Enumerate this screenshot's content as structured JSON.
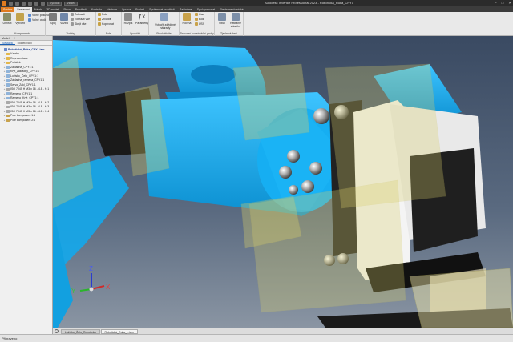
{
  "window": {
    "title": "Autodesk Inventor Professional 2023 - Robotická_Ruka_CPY1",
    "document_combo": "Výchozí",
    "appearance_combo": "Vzhled"
  },
  "tabs": [
    {
      "label": "Soubor",
      "state": "file"
    },
    {
      "label": "Sestavení",
      "state": "active"
    },
    {
      "label": "Návrh",
      "state": ""
    },
    {
      "label": "3D model",
      "state": ""
    },
    {
      "label": "Skica",
      "state": ""
    },
    {
      "label": "Prostředí",
      "state": ""
    },
    {
      "label": "Kontrola",
      "state": ""
    },
    {
      "label": "Nástroje",
      "state": ""
    },
    {
      "label": "Správa",
      "state": ""
    },
    {
      "label": "Pohled",
      "state": ""
    },
    {
      "label": "Systémové prostředí",
      "state": ""
    },
    {
      "label": "Začínáme",
      "state": ""
    },
    {
      "label": "Spolupracovat",
      "state": ""
    },
    {
      "label": "Elektromechanické",
      "state": ""
    }
  ],
  "ribbon": {
    "komponenta": {
      "label": "Komponenta",
      "place": "Umístit",
      "create": "Vytvořit",
      "free_move": "Volně posunout",
      "free_rotate": "Volně otočit"
    },
    "vztahy": {
      "label": "Vztahy",
      "join": "Spoj",
      "constrain": "Vazba",
      "show": "Zobrazit",
      "show_all": "Zobrazit vše",
      "hide_all": "Skrýt vše"
    },
    "pole": {
      "label": "Pole",
      "pattern": "Pole",
      "mirror": "Zrcadlit",
      "copy": "Kopírovat"
    },
    "spoustec": {
      "label": "Spouště",
      "design": "Rozpis",
      "params": "Parametry"
    },
    "produktivita": {
      "label": "Produktivita",
      "create_subs": "Vytvořit zděděné náhrady"
    },
    "pracovni": {
      "label": "Pracovní konstrukční prvky",
      "plane": "Rovina",
      "axis": "Osa",
      "point": "Bod",
      "ucs": "USS"
    },
    "zjednoduseni": {
      "label": "Zjednodušení",
      "wrap": "Obal",
      "shrinkwrap": "Rektálně zdadění"
    }
  },
  "browser": {
    "header": "Model",
    "add": "+",
    "tab_assembly": "Sestava",
    "tab_model": "Modelování",
    "tree": [
      {
        "label": "Robotická_Ruka_CPY1.iam",
        "level": 0,
        "icon": "assembly-icon",
        "expand": "-"
      },
      {
        "label": "Vztahy",
        "level": 1,
        "icon": "folder-icon",
        "expand": "+"
      },
      {
        "label": "Reprezentace",
        "level": 1,
        "icon": "folder-icon",
        "expand": "+"
      },
      {
        "label": "Počátek",
        "level": 1,
        "icon": "folder-icon",
        "expand": "+"
      },
      {
        "label": "Základna_CPY1:1",
        "level": 1,
        "icon": "part-icon",
        "expand": "+"
      },
      {
        "label": "Kryt_základny_CPY1:1",
        "level": 1,
        "icon": "part-icon",
        "expand": "+"
      },
      {
        "label": "Ložisko_Čelo_CPY1:1",
        "level": 1,
        "icon": "part-icon",
        "expand": "+"
      },
      {
        "label": "Základna_ramena_CPY1:1",
        "level": 1,
        "icon": "part-icon",
        "expand": "+"
      },
      {
        "label": "Servo_Zákl_CPY1:1",
        "level": 1,
        "icon": "part-icon",
        "expand": "+"
      },
      {
        "label": "ISO 7045 H M3 x 16 - 4.8 - H:1",
        "level": 1,
        "icon": "bolt-icon",
        "expand": "+"
      },
      {
        "label": "Rameno_CPY1:1",
        "level": 1,
        "icon": "part-icon",
        "expand": "+"
      },
      {
        "label": "Rameno_Kryt_CPY1:1",
        "level": 1,
        "icon": "part-icon",
        "expand": "+"
      },
      {
        "label": "ISO 7045 H M3 x 16 - 4.8 - H:2",
        "level": 1,
        "icon": "bolt-icon",
        "expand": "+"
      },
      {
        "label": "ISO 7045 H M3 x 16 - 4.8 - H:3",
        "level": 1,
        "icon": "bolt-icon",
        "expand": "+"
      },
      {
        "label": "ISO 7045 H M3 x 16 - 4.8 - H:4",
        "level": 1,
        "icon": "bolt-icon",
        "expand": "+"
      },
      {
        "label": "Pole komponent 1:1",
        "level": 1,
        "icon": "pattern-icon",
        "expand": "+"
      },
      {
        "label": "Pole komponent 2:1",
        "level": 1,
        "icon": "pattern-icon",
        "expand": "+"
      }
    ]
  },
  "viewcube": {
    "x": "X",
    "y": "Y",
    "z": "Z"
  },
  "doc_tabs": [
    {
      "label": "Ložisko_Čelo_Robotická",
      "active": false
    },
    {
      "label": "Robotická_Ruka_...iam",
      "active": true
    }
  ],
  "status": "Připraveno",
  "colors": {
    "accent_orange": "#e07b1f",
    "arm_blue": "#13a9ec",
    "viewport_bg_top": "#3a4a62",
    "viewport_bg_bottom": "#8a95a3",
    "work_plane": "#d9cf6b"
  }
}
